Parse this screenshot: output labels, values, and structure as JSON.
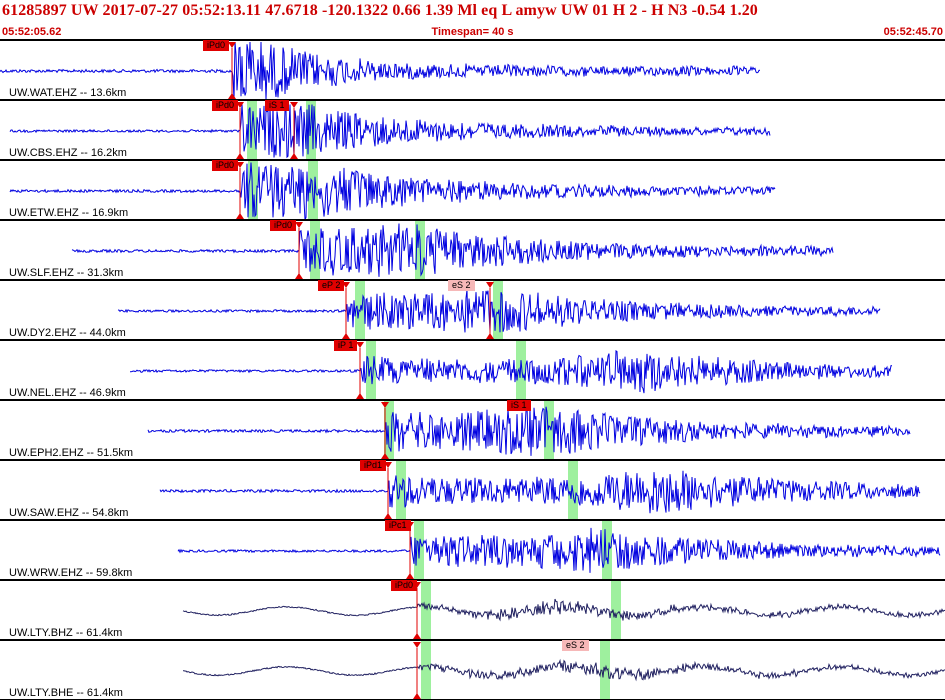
{
  "header": {
    "title": "61285897 UW 2017-07-27 05:52:13.11   47.6718 -120.1322   0.66  1.39 Ml  eq  L amyw     UW 01  H   2  -  H N3   -0.54  1.20",
    "start_time": "05:52:05.62",
    "timespan": "Timespan=  40 s",
    "end_time": "05:52:45.70"
  },
  "colors": {
    "trace": "#0000e0",
    "trace_long_period": "#202060",
    "pick_strong": "#e00000",
    "pick_weak": "#f6b8b8",
    "window": "#9ef09e",
    "text_red": "#cc0000"
  },
  "traces": [
    {
      "station": "UW.WAT.EHZ -- 13.6km",
      "picks": [
        {
          "label": "iPd0",
          "style": "strong"
        }
      ]
    },
    {
      "station": "UW.CBS.EHZ -- 16.2km",
      "picks": [
        {
          "label": "iPd0",
          "style": "strong"
        },
        {
          "label": "iS 1",
          "style": "strong"
        }
      ]
    },
    {
      "station": "UW.ETW.EHZ -- 16.9km",
      "picks": [
        {
          "label": "iPd0",
          "style": "strong"
        }
      ]
    },
    {
      "station": "UW.SLF.EHZ -- 31.3km",
      "picks": [
        {
          "label": "iPd0",
          "style": "strong"
        }
      ]
    },
    {
      "station": "UW.DY2.EHZ -- 44.0km",
      "picks": [
        {
          "label": "eP 2",
          "style": "strong"
        },
        {
          "label": "eS 2",
          "style": "weak"
        }
      ]
    },
    {
      "station": "UW.NEL.EHZ -- 46.9km",
      "picks": [
        {
          "label": "iP 1",
          "style": "strong"
        }
      ]
    },
    {
      "station": "UW.EPH2.EHZ -- 51.5km",
      "picks": [
        {
          "label": "iS 1",
          "style": "strong"
        }
      ]
    },
    {
      "station": "UW.SAW.EHZ -- 54.8km",
      "picks": [
        {
          "label": "iPd1",
          "style": "strong"
        }
      ]
    },
    {
      "station": "UW.WRW.EHZ -- 59.8km",
      "picks": [
        {
          "label": "iPc1",
          "style": "strong"
        }
      ]
    },
    {
      "station": "UW.LTY.BHZ -- 61.4km",
      "picks": [
        {
          "label": "iPd0",
          "style": "strong"
        }
      ]
    },
    {
      "station": "UW.LTY.BHE -- 61.4km",
      "picks": [
        {
          "label": "eS 2",
          "style": "weak"
        }
      ]
    }
  ]
}
